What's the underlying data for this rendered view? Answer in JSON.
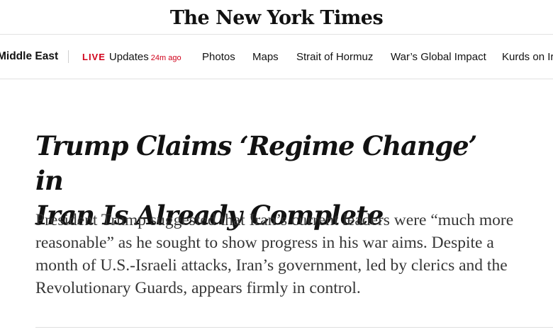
{
  "masthead": {
    "logo": "The New York Times"
  },
  "nav": {
    "section": "Middle East",
    "live_tag": "LIVE",
    "live_label": "Updates",
    "live_time": "24m ago",
    "items": [
      {
        "label": "Photos"
      },
      {
        "label": "Maps"
      },
      {
        "label": "Strait of Hormuz"
      },
      {
        "label": "War’s Global Impact"
      },
      {
        "label": "Kurds on Ir"
      }
    ]
  },
  "article": {
    "headline_line1": "Trump Claims ‘Regime Change’ in",
    "headline_line2": "Iran Is Already Complete",
    "summary": "President Trump suggested that Iran’s current leaders were “much more reasonable” as he sought to show progress in his war aims. Despite a month of U.S.-Israeli attacks, Iran’s government, led by clerics and the Revolutionary Guards, appears firmly in control."
  },
  "colors": {
    "live_red": "#d0021b",
    "text": "#121212",
    "summary_text": "#363636",
    "rule": "#e2e2e2"
  }
}
